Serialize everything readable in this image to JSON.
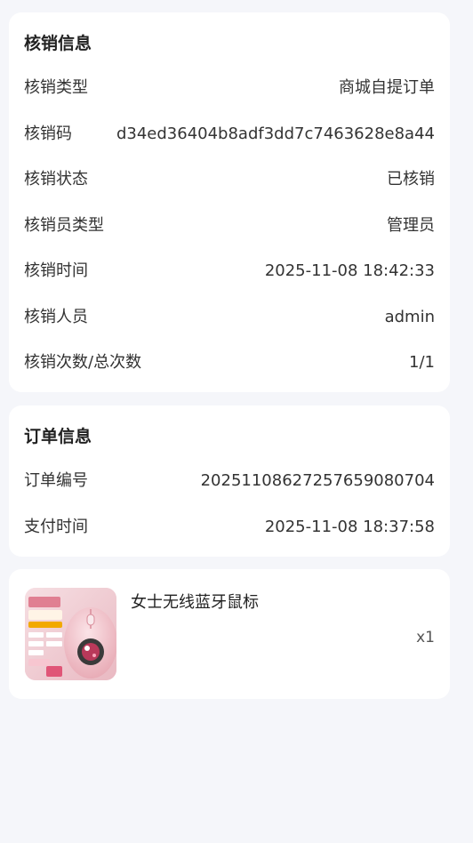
{
  "verify_info": {
    "title": "核销信息",
    "rows": [
      {
        "label": "核销类型",
        "value": "商城自提订单"
      },
      {
        "label": "核销码",
        "value": "d34ed36404b8adf3dd7c7463628e8a44"
      },
      {
        "label": "核销状态",
        "value": "已核销"
      },
      {
        "label": "核销员类型",
        "value": "管理员"
      },
      {
        "label": "核销时间",
        "value": "2025-11-08 18:42:33"
      },
      {
        "label": "核销人员",
        "value": "admin"
      },
      {
        "label": "核销次数/总次数",
        "value": "1/1"
      }
    ]
  },
  "order_info": {
    "title": "订单信息",
    "rows": [
      {
        "label": "订单编号",
        "value": "2025110862725765908070​4"
      },
      {
        "label": "支付时间",
        "value": "2025-11-08 18:37:58"
      }
    ]
  },
  "goods": {
    "name": "女士无线蓝牙鼠标",
    "quantity": "x1",
    "image_icon": "pink-mouse-product-image"
  }
}
